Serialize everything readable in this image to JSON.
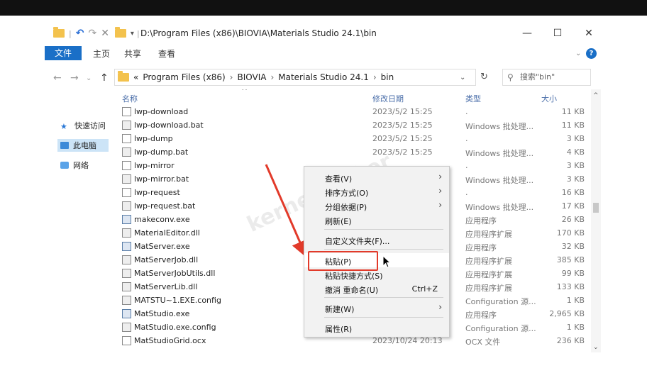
{
  "window": {
    "path_title": "D:\\Program Files (x86)\\BIOVIA\\Materials Studio 24.1\\bin",
    "controls": {
      "minimize": "—",
      "maximize": "☐",
      "close": "✕"
    }
  },
  "ribbon": {
    "tabs": [
      "文件",
      "主页",
      "共享",
      "查看"
    ]
  },
  "address": {
    "prefix": "«",
    "crumbs": [
      "Program Files (x86)",
      "BIOVIA",
      "Materials Studio 24.1",
      "bin"
    ],
    "separator": "›",
    "search_placeholder": "搜索\"bin\""
  },
  "sidebar": {
    "items": [
      "快速访问",
      "此电脑",
      "网络"
    ]
  },
  "columns": {
    "name": "名称",
    "date": "修改日期",
    "type": "类型",
    "size": "大小"
  },
  "files": [
    {
      "name": "lwp-download",
      "date": "2023/5/2 15:25",
      "type": ".",
      "size": "11 KB",
      "icon": "file"
    },
    {
      "name": "lwp-download.bat",
      "date": "2023/5/2 15:25",
      "type": "Windows 批处理...",
      "size": "11 KB",
      "icon": "bat"
    },
    {
      "name": "lwp-dump",
      "date": "2023/5/2 15:25",
      "type": ".",
      "size": "3 KB",
      "icon": "file"
    },
    {
      "name": "lwp-dump.bat",
      "date": "2023/5/2 15:25",
      "type": "Windows 批处理...",
      "size": "4 KB",
      "icon": "bat"
    },
    {
      "name": "lwp-mirror",
      "date": "",
      "type": ".",
      "size": "3 KB",
      "icon": "file"
    },
    {
      "name": "lwp-mirror.bat",
      "date": "",
      "type": "Windows 批处理...",
      "size": "3 KB",
      "icon": "bat"
    },
    {
      "name": "lwp-request",
      "date": "",
      "type": ".",
      "size": "16 KB",
      "icon": "file"
    },
    {
      "name": "lwp-request.bat",
      "date": "",
      "type": "Windows 批处理...",
      "size": "17 KB",
      "icon": "bat"
    },
    {
      "name": "makeconv.exe",
      "date": "",
      "type": "应用程序",
      "size": "26 KB",
      "icon": "exe"
    },
    {
      "name": "MaterialEditor.dll",
      "date": "",
      "type": "应用程序扩展",
      "size": "170 KB",
      "icon": "dll"
    },
    {
      "name": "MatServer.exe",
      "date": "",
      "type": "应用程序",
      "size": "32 KB",
      "icon": "exe"
    },
    {
      "name": "MatServerJob.dll",
      "date": "",
      "type": "应用程序扩展",
      "size": "385 KB",
      "icon": "dll"
    },
    {
      "name": "MatServerJobUtils.dll",
      "date": "",
      "type": "应用程序扩展",
      "size": "99 KB",
      "icon": "dll"
    },
    {
      "name": "MatServerLib.dll",
      "date": "",
      "type": "应用程序扩展",
      "size": "133 KB",
      "icon": "dll"
    },
    {
      "name": "MATSTU~1.EXE.config",
      "date": "",
      "type": "Configuration 源...",
      "size": "1 KB",
      "icon": "config"
    },
    {
      "name": "MatStudio.exe",
      "date": "",
      "type": "应用程序",
      "size": "2,965 KB",
      "icon": "exe"
    },
    {
      "name": "MatStudio.exe.config",
      "date": "",
      "type": "Configuration 源...",
      "size": "1 KB",
      "icon": "config"
    },
    {
      "name": "MatStudioGrid.ocx",
      "date": "2023/10/24 20:13",
      "type": "OCX 文件",
      "size": "236 KB",
      "icon": "file"
    }
  ],
  "context_menu": {
    "view": "查看(V)",
    "sort": "排序方式(O)",
    "group": "分组依据(P)",
    "refresh": "刷新(E)",
    "customize": "自定义文件夹(F)...",
    "paste": "粘贴(P)",
    "paste_shortcut": "粘贴快捷方式(S)",
    "undo": "撤消 重命名(U)",
    "undo_shortcut": "Ctrl+Z",
    "new": "新建(W)",
    "properties": "属性(R)"
  },
  "watermark": "kernelhacker",
  "colors": {
    "accent": "#1a6fc7",
    "highlight": "#e23a2a",
    "selection": "#cce4f7"
  }
}
